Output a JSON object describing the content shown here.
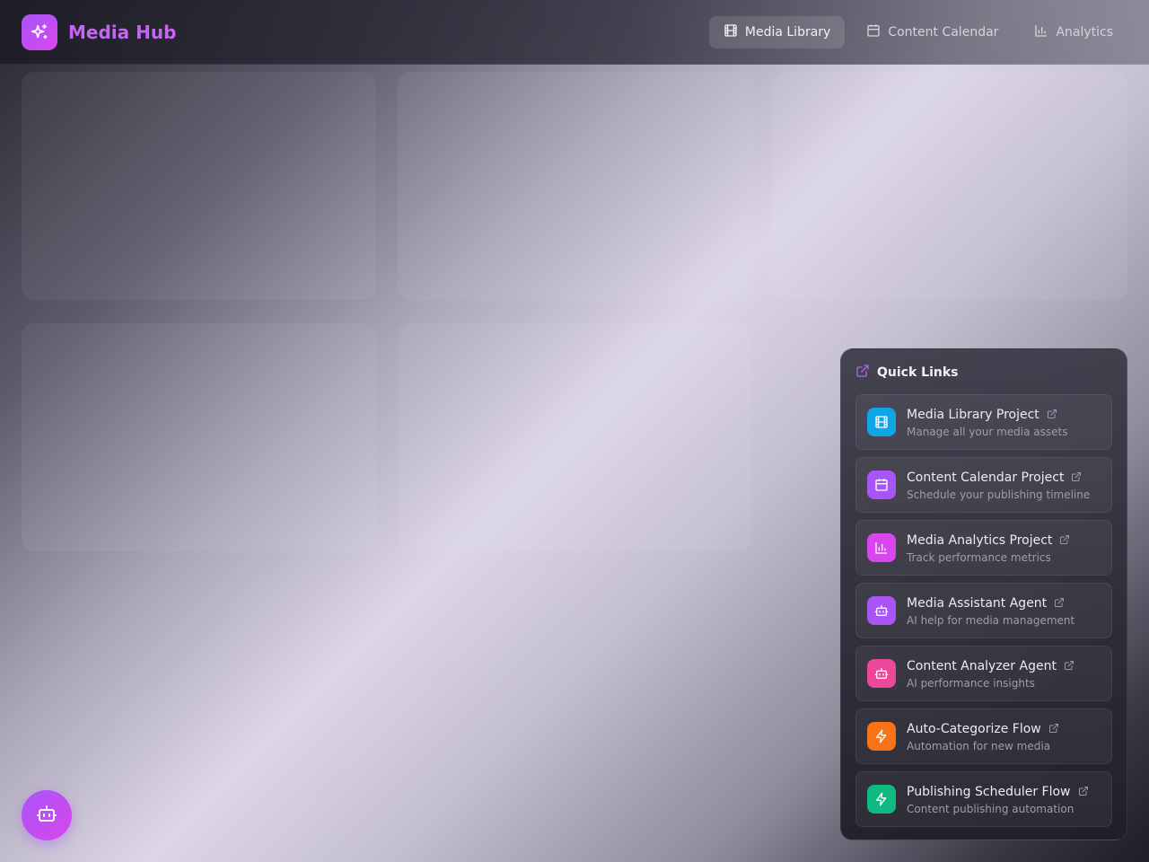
{
  "header": {
    "brand_name": "Media Hub",
    "logo_icon": "sparkles-icon",
    "nav": [
      {
        "label": "Media Library",
        "icon": "film-icon",
        "active": true
      },
      {
        "label": "Content Calendar",
        "icon": "calendar-icon",
        "active": false
      },
      {
        "label": "Analytics",
        "icon": "bar-chart-icon",
        "active": false
      }
    ]
  },
  "quick_links": {
    "title": "Quick Links",
    "icon": "external-link-icon",
    "items": [
      {
        "title": "Media Library Project",
        "description": "Manage all your media assets",
        "icon": "film-icon",
        "color": "#0ea5e9"
      },
      {
        "title": "Content Calendar Project",
        "description": "Schedule your publishing timeline",
        "icon": "calendar-icon",
        "color": "#a855f7"
      },
      {
        "title": "Media Analytics Project",
        "description": "Track performance metrics",
        "icon": "bar-chart-icon",
        "color": "#d946ef"
      },
      {
        "title": "Media Assistant Agent",
        "description": "AI help for media management",
        "icon": "bot-icon",
        "color": "#a855f7"
      },
      {
        "title": "Content Analyzer Agent",
        "description": "AI performance insights",
        "icon": "bot-icon",
        "color": "#ec4899"
      },
      {
        "title": "Auto-Categorize Flow",
        "description": "Automation for new media",
        "icon": "zap-icon",
        "color": "#f97316"
      },
      {
        "title": "Publishing Scheduler Flow",
        "description": "Content publishing automation",
        "icon": "zap-icon",
        "color": "#10b981"
      }
    ]
  },
  "fab": {
    "icon": "bot-icon"
  },
  "colors": {
    "brand": "#c566f0",
    "accent_gradient_start": "#a855f7",
    "accent_gradient_end": "#d946ef"
  }
}
